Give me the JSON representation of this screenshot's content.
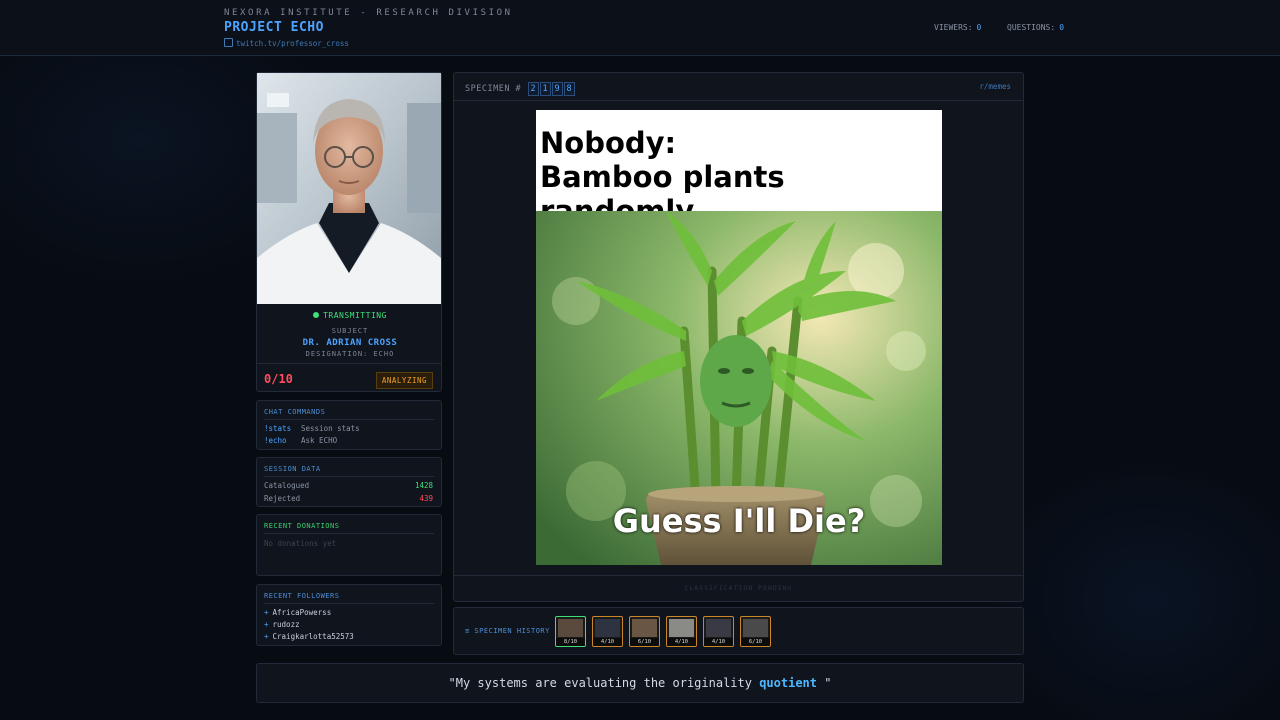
{
  "header": {
    "org": "NEXORA INSTITUTE - RESEARCH DIVISION",
    "project": "PROJECT ECHO",
    "link": "twitch.tv/professor_cross",
    "viewers_label": "VIEWERS:",
    "viewers_value": "0",
    "questions_label": "QUESTIONS:",
    "questions_value": "0"
  },
  "subject": {
    "status": "TRANSMITTING",
    "label": "SUBJECT",
    "name": "DR. ADRIAN CROSS",
    "designation": "DESIGNATION: ECHO",
    "score": "0/10",
    "state_badge": "ANALYZING"
  },
  "commands": {
    "title": "CHAT COMMANDS",
    "items": [
      {
        "cmd": "!stats",
        "desc": "Session stats"
      },
      {
        "cmd": "!echo",
        "desc": "Ask ECHO"
      }
    ]
  },
  "session": {
    "title": "SESSION DATA",
    "catalogued_label": "Catalogued",
    "catalogued_value": "1428",
    "rejected_label": "Rejected",
    "rejected_value": "439"
  },
  "donations": {
    "title": "RECENT DONATIONS",
    "empty": "No donations yet"
  },
  "followers": {
    "title": "RECENT FOLLOWERS",
    "items": [
      "AfricaPowerss",
      "rudozz",
      "Craigkarlotta52573"
    ]
  },
  "specimen": {
    "label": "SPECIMEN #",
    "digits": [
      "2",
      "1",
      "9",
      "8"
    ],
    "source": "r/memes",
    "meme_line1": "Nobody:",
    "meme_line2": "Bamboo plants randomly",
    "meme_bottom": "Guess I'll Die?",
    "footer": "CLASSIFICATION PENDING"
  },
  "history": {
    "label": "≡ SPECIMEN HISTORY",
    "scores": [
      "8/10",
      "4/10",
      "6/10",
      "4/10",
      "4/10",
      "6/10"
    ]
  },
  "quote": {
    "before": "\"My systems are evaluating the originality ",
    "highlight": "quotient",
    "after": " \""
  },
  "colors": {
    "accent": "#4da3ff",
    "green": "#3ee07a",
    "red": "#ff4d5e",
    "orange": "#f0a030"
  }
}
